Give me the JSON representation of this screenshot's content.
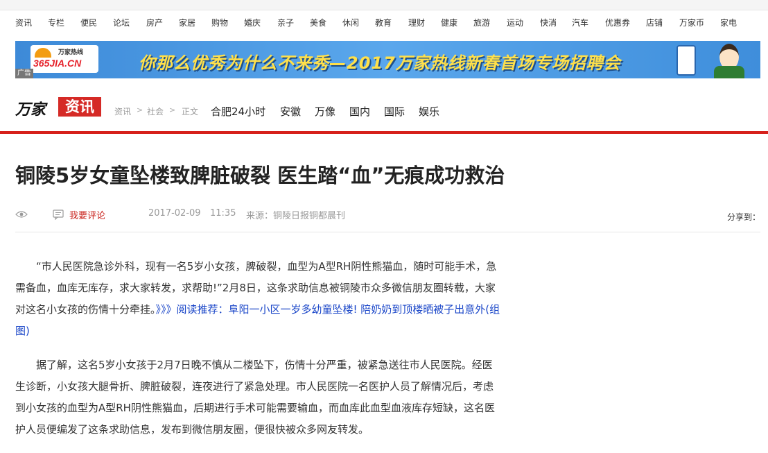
{
  "nav": [
    "资讯",
    "专栏",
    "便民",
    "论坛",
    "房产",
    "家居",
    "购物",
    "婚庆",
    "亲子",
    "美食",
    "休闲",
    "教育",
    "理财",
    "健康",
    "旅游",
    "运动",
    "快消",
    "汽车",
    "优惠券",
    "店铺",
    "万家币",
    "家电"
  ],
  "banner": {
    "logo_text": "365JIA.CN",
    "logo_sub": "万家热线",
    "headline": "你那么优秀为什么不来秀—2017万家热线新春首场专场招聘会",
    "ad_tag": "广告"
  },
  "brand": {
    "wan": "万家",
    "zixun": "资讯"
  },
  "breadcrumb": {
    "items": [
      "资讯",
      "社会",
      "正文"
    ],
    "sep": ">"
  },
  "channels": [
    "合肥24小时",
    "安徽",
    "万像",
    "国内",
    "国际",
    "娱乐"
  ],
  "article": {
    "title": "铜陵5岁女童坠楼致脾脏破裂 医生踏“血”无痕成功救治",
    "comment_label": "我要评论",
    "date": "2017-02-09",
    "time": "11:35",
    "source": "来源：铜陵日报铜都晨刊",
    "share_label": "分享到：",
    "p1_text": "“市人民医院急诊外科，现有一名5岁小女孩，脾破裂，血型为A型RH阴性熊猫血，随时可能手术，急需备血，血库无库存，求大家转发，求帮助!”2月8日，这条求助信息被铜陵市众多微信朋友圈转载，大家对这名小女孩的伤情十分牵挂。",
    "p1_link": "》》》阅读推荐：阜阳一小区一岁多幼童坠楼! 陪奶奶到顶楼晒被子出意外(组图)",
    "p2_text": "据了解，这名5岁小女孩于2月7日晚不慎从二楼坠下，伤情十分严重，被紧急送往市人民医院。经医生诊断，小女孩大腿骨折、脾脏破裂，连夜进行了紧急处理。市人民医院一名医护人员了解情况后，考虑到小女孩的血型为A型RH阴性熊猫血，后期进行手术可能需要输血，而血库此血型血液库存短缺，这名医护人员便编发了这条求助信息，发布到微信朋友圈，便很快被众多网友转发。"
  }
}
